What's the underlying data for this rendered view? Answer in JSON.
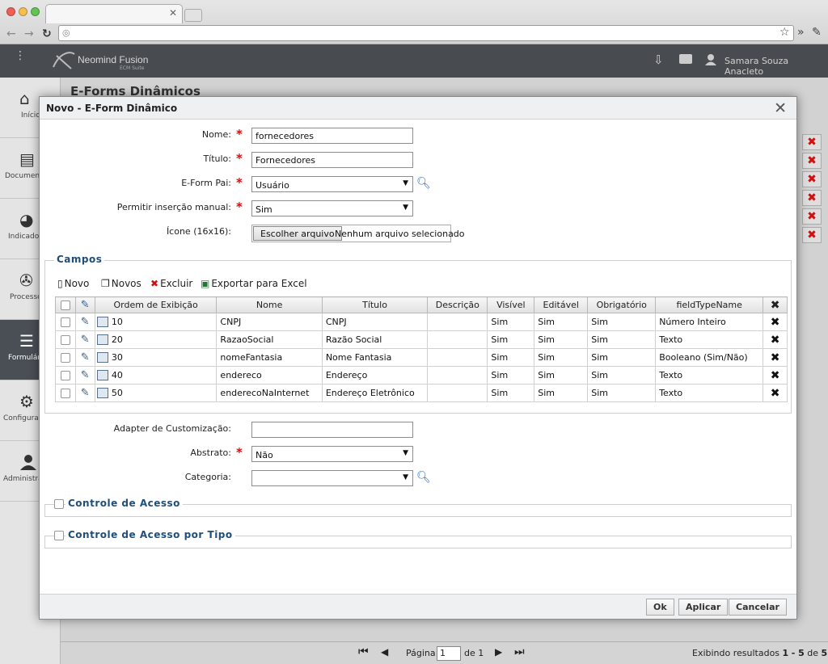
{
  "app": {
    "brand": "Neomind Fusion",
    "brand_sub": "ECM Suite",
    "user": "Samara Souza Anacleto",
    "page_title": "E-Forms Dinâmicos"
  },
  "sidebar": {
    "items": [
      {
        "label": "Início"
      },
      {
        "label": "Documentos"
      },
      {
        "label": "Indicadores"
      },
      {
        "label": "Processos"
      },
      {
        "label": "Formulários"
      },
      {
        "label": "Configurações"
      },
      {
        "label": "Administração"
      }
    ]
  },
  "pager": {
    "pagina_label": "Página",
    "page_value": "1",
    "de_label": "de 1",
    "results_prefix": "Exibindo resultados",
    "results_from": "1",
    "results_to": "- 5",
    "results_de": "de",
    "results_total": "5"
  },
  "modal": {
    "title": "Novo - E-Form Dinâmico",
    "form": {
      "nome_label": "Nome:",
      "nome_value": "fornecedores",
      "titulo_label": "Título:",
      "titulo_value": "Fornecedores",
      "pai_label": "E-Form Pai:",
      "pai_value": "Usuário",
      "manual_label": "Permitir inserção manual:",
      "manual_value": "Sim",
      "icone_label": "Ícone (16x16):",
      "file_button": "Escolher arquivo",
      "file_status": "Nenhum arquivo selecionado",
      "adapter_label": "Adapter de Customização:",
      "adapter_value": "",
      "abstrato_label": "Abstrato:",
      "abstrato_value": "Não",
      "categoria_label": "Categoria:",
      "categoria_value": ""
    },
    "campos": {
      "legend": "Campos",
      "toolbar": {
        "novo": "Novo",
        "novos": "Novos",
        "excluir": "Excluir",
        "exportar": "Exportar para Excel"
      },
      "columns": [
        "Ordem de Exibição",
        "Nome",
        "Título",
        "Descrição",
        "Visível",
        "Editável",
        "Obrigatório",
        "fieldTypeName"
      ],
      "rows": [
        {
          "ordem": "10",
          "nome": "CNPJ",
          "titulo": "CNPJ",
          "descricao": "",
          "visivel": "Sim",
          "editavel": "Sim",
          "obrigatorio": "Sim",
          "tipo": "Número Inteiro"
        },
        {
          "ordem": "20",
          "nome": "RazaoSocial",
          "titulo": "Razão Social",
          "descricao": "",
          "visivel": "Sim",
          "editavel": "Sim",
          "obrigatorio": "Sim",
          "tipo": "Texto"
        },
        {
          "ordem": "30",
          "nome": "nomeFantasia",
          "titulo": "Nome Fantasia",
          "descricao": "",
          "visivel": "Sim",
          "editavel": "Sim",
          "obrigatorio": "Sim",
          "tipo": "Booleano (Sim/Não)"
        },
        {
          "ordem": "40",
          "nome": "endereco",
          "titulo": "Endereço",
          "descricao": "",
          "visivel": "Sim",
          "editavel": "Sim",
          "obrigatorio": "Sim",
          "tipo": "Texto"
        },
        {
          "ordem": "50",
          "nome": "enderecoNaInternet",
          "titulo": "Endereço Eletrônico",
          "descricao": "",
          "visivel": "Sim",
          "editavel": "Sim",
          "obrigatorio": "Sim",
          "tipo": "Texto"
        }
      ]
    },
    "controle_acesso": "Controle de Acesso",
    "controle_acesso_tipo": "Controle de Acesso por Tipo",
    "buttons": {
      "ok": "Ok",
      "aplicar": "Aplicar",
      "cancelar": "Cancelar"
    }
  },
  "colors": {
    "accent": "#1e4e7a",
    "danger": "#d01010",
    "appbar": "#484c50"
  }
}
